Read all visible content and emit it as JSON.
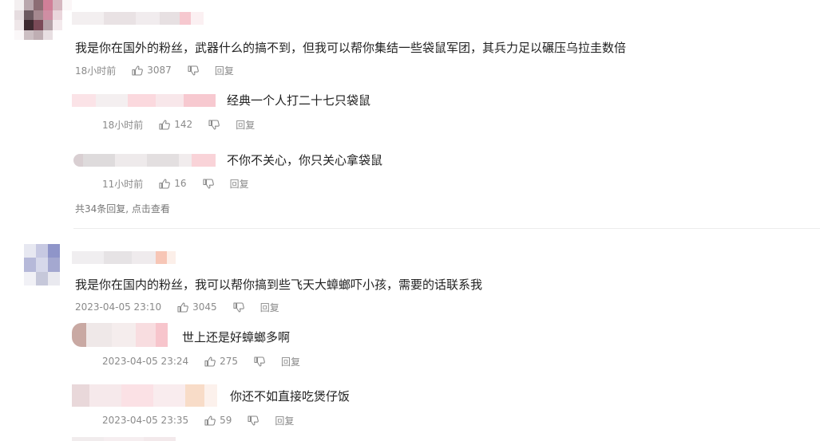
{
  "thread1": {
    "text": "我是你在国外的粉丝，武器什么的搞不到，但我可以帮你集结一些袋鼠军团，其兵力足以碾压乌拉圭数倍",
    "time": "18小时前",
    "likes": "3087",
    "reply_label": "回复",
    "replies": [
      {
        "text": "经典一个人打二十七只袋鼠",
        "time": "18小时前",
        "likes": "142",
        "reply_label": "回复"
      },
      {
        "text": "不你不关心，你只关心拿袋鼠",
        "time": "11小时前",
        "likes": "16",
        "reply_label": "回复"
      }
    ],
    "more": "共34条回复, 点击查看"
  },
  "thread2": {
    "text": "我是你在国内的粉丝，我可以帮你搞到些飞天大蟑螂吓小孩，需要的话联系我",
    "time": "2023-04-05 23:10",
    "likes": "3045",
    "reply_label": "回复",
    "replies": [
      {
        "text": "世上还是好蟑螂多啊",
        "time": "2023-04-05 23:24",
        "likes": "275",
        "reply_label": "回复"
      },
      {
        "text": "你还不如直接吃煲仔饭",
        "time": "2023-04-05 23:35",
        "likes": "59",
        "reply_label": "回复"
      }
    ]
  },
  "icons": {
    "like": "thumb-up-icon",
    "dislike": "thumb-down-icon"
  },
  "colors": {
    "text": "#222222",
    "meta": "#8a8a8a",
    "divider": "#ececec"
  }
}
